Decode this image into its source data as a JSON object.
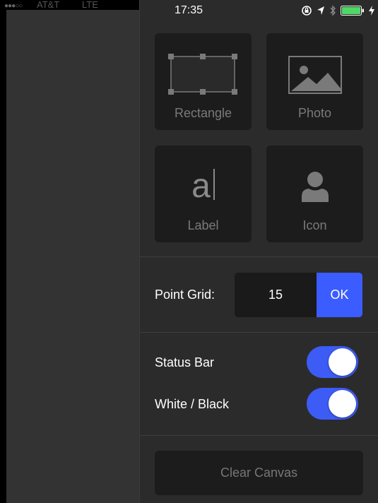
{
  "left_status": {
    "carrier": "AT&T",
    "network": "LTE"
  },
  "status_bar": {
    "time": "17:35",
    "icons": [
      "orientation-lock-icon",
      "location-arrow-icon",
      "bluetooth-icon",
      "battery-icon",
      "charging-bolt-icon"
    ]
  },
  "elements": {
    "rectangle": {
      "label": "Rectangle",
      "icon": "rectangle-icon"
    },
    "photo": {
      "label": "Photo",
      "icon": "photo-icon"
    },
    "label": {
      "label": "Label",
      "icon": "text-a-icon",
      "glyph": "a"
    },
    "icon": {
      "label": "Icon",
      "icon": "person-icon"
    }
  },
  "point_grid": {
    "label": "Point Grid:",
    "value": "15",
    "ok_label": "OK"
  },
  "toggles": [
    {
      "label": "Status Bar",
      "on": true
    },
    {
      "label": "White / Black",
      "on": true
    }
  ],
  "clear_canvas": {
    "label": "Clear Canvas"
  },
  "colors": {
    "accent": "#3b5cff",
    "tile": "#1c1c1c",
    "panel": "#2b2b2b",
    "battery": "#4cd964"
  }
}
